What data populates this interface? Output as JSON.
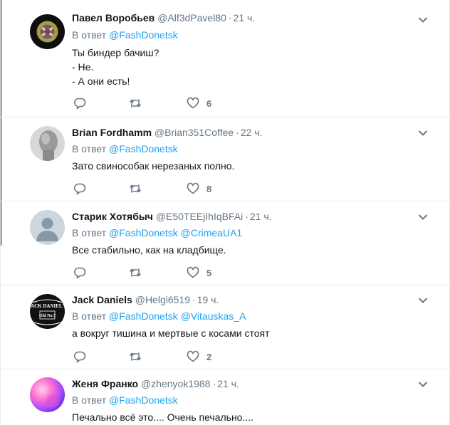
{
  "tweets": [
    {
      "name": "Павел Воробьев",
      "handle": "@Alf3dPavel80",
      "time": "21 ч.",
      "reply_label": "В ответ",
      "mentions": [
        "@FashDonetsk"
      ],
      "text_lines": [
        "Ты биндер бачиш?",
        "- Не.",
        "- А они есть!"
      ],
      "likes": "6",
      "avatar": "emblem-avatar"
    },
    {
      "name": "Brian Fordhamm",
      "handle": "@Brian351Coffee",
      "time": "22 ч.",
      "reply_label": "В ответ",
      "mentions": [
        "@FashDonetsk"
      ],
      "text_lines": [
        "Зато свинособак нерезаных полно."
      ],
      "likes": "8",
      "avatar": "grey-head-avatar"
    },
    {
      "name": "Старик Хотябыч",
      "handle": "@E50TEEjIhIqBFAi",
      "time": "21 ч.",
      "reply_label": "В ответ",
      "mentions": [
        "@FashDonetsk",
        "@CrimeaUA1"
      ],
      "text_lines": [
        "Все стабильно, как на кладбище."
      ],
      "likes": "5",
      "avatar": "default-avatar"
    },
    {
      "name": "Jack Daniels",
      "handle": "@Helgi6519",
      "time": "19 ч.",
      "reply_label": "В ответ",
      "mentions": [
        "@FashDonetsk",
        "@Vitauskas_A"
      ],
      "text_lines": [
        "а вокруг тишина и мертвые с косами стоят"
      ],
      "likes": "2",
      "avatar": "whiskey-label-avatar"
    },
    {
      "name": "Женя Франко",
      "handle": "@zhenyok1988",
      "time": "21 ч.",
      "reply_label": "В ответ",
      "mentions": [
        "@FashDonetsk"
      ],
      "text_lines": [
        "Печально всё это.... Очень печально...."
      ],
      "likes": "",
      "avatar": "gradient-avatar"
    }
  ],
  "avatar_label": {
    "jack_line1": "JACK DANIEL'S",
    "jack_line2": "Old No.7"
  },
  "colors": {
    "accent": "#1da1f2",
    "muted": "#657786",
    "text": "#14171a",
    "border": "#e6ecf0"
  }
}
